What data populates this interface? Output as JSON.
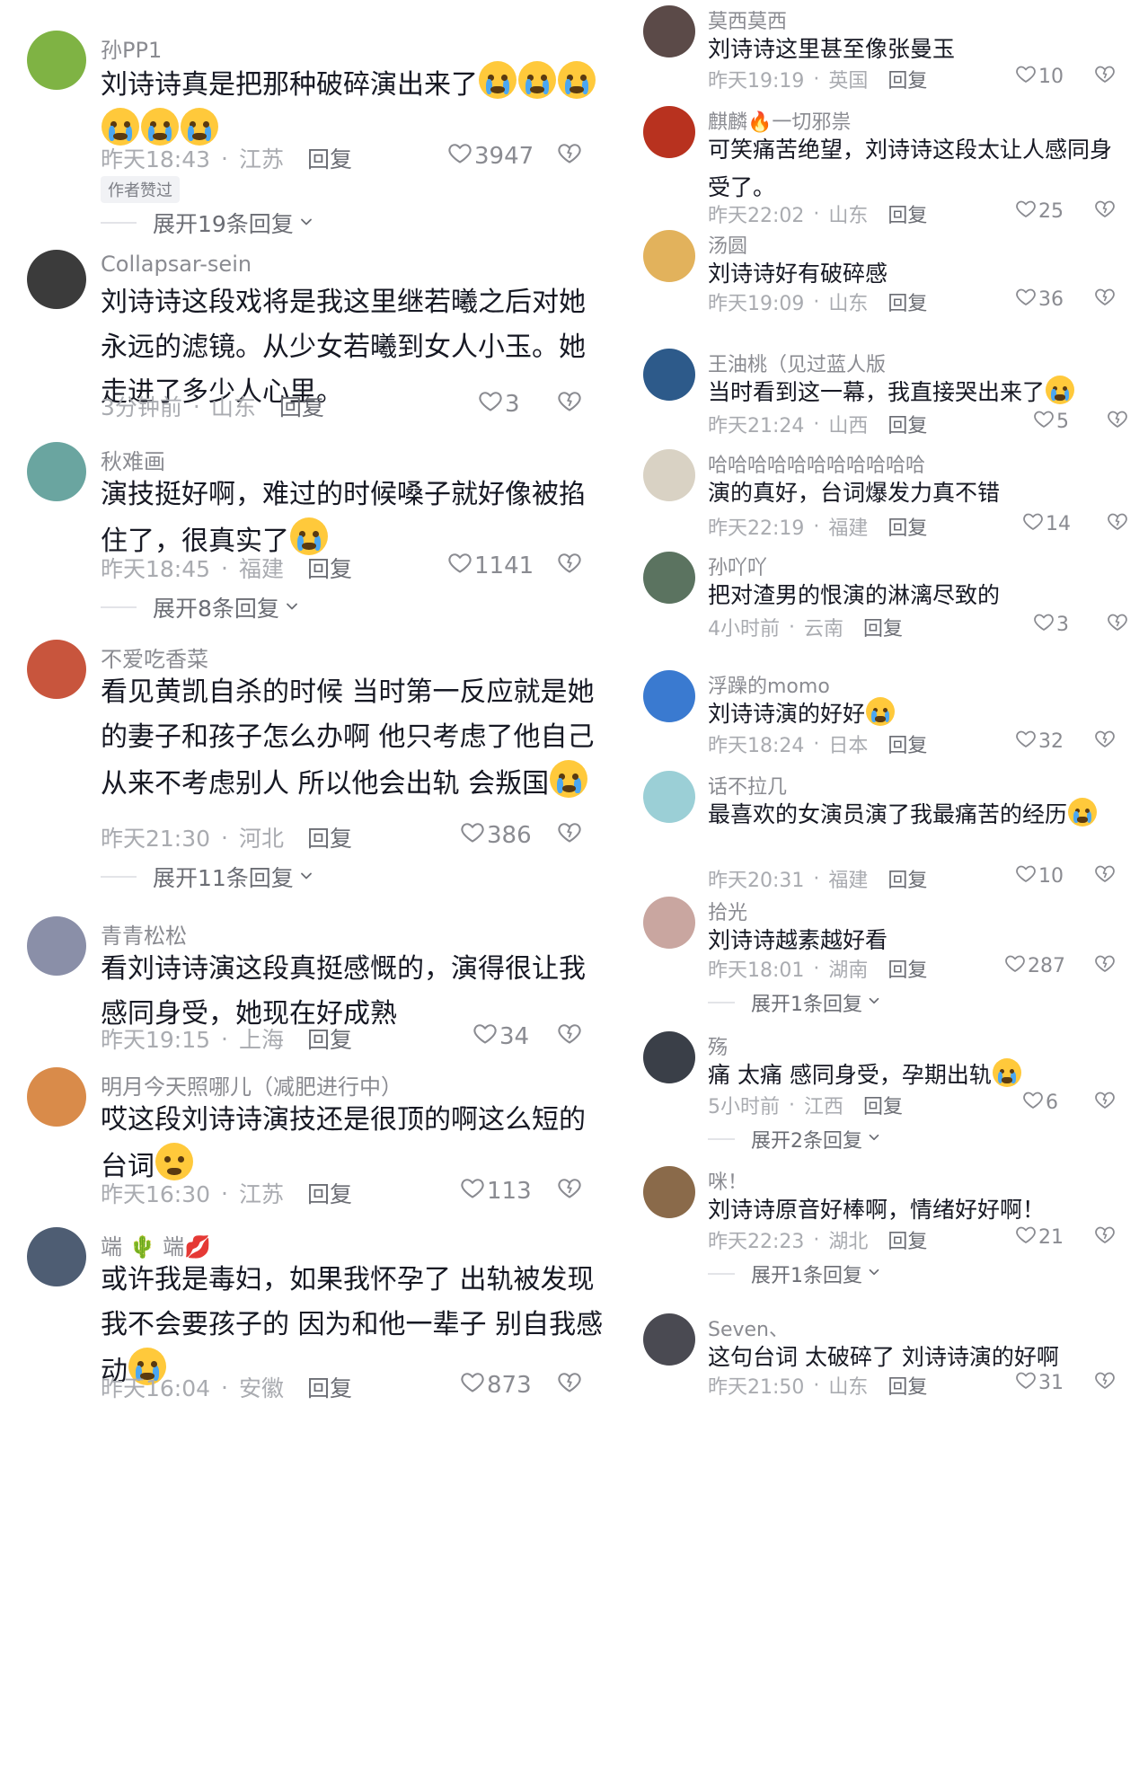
{
  "left": [
    {
      "name": "孙PP1",
      "text": "刘诗诗真是把那种破碎演出来了",
      "emojis": [
        "plead",
        "plead",
        "plead",
        "cry",
        "cry",
        "cry"
      ],
      "time": "昨天18:43",
      "location": "江苏",
      "reply": "回复",
      "likes": "3947",
      "author_tag": "作者赞过",
      "expand": "展开19条回复",
      "avatar_color": "#7fb344"
    },
    {
      "name": "Collapsar-sein",
      "text": "刘诗诗这段戏将是我这里继若曦之后对她永远的滤镜。从少女若曦到女人小玉。她走进了多少人心里。",
      "emojis": [],
      "time": "3分钟前",
      "location": "山东",
      "reply": "回复",
      "likes": "3",
      "avatar_color": "#3b3b3b"
    },
    {
      "name": "秋难画",
      "text": "演技挺好啊，难过的时候嗓子就好像被掐住了，很真实了",
      "emojis": [
        "cry"
      ],
      "time": "昨天18:45",
      "location": "福建",
      "reply": "回复",
      "likes": "1141",
      "expand": "展开8条回复",
      "avatar_color": "#6aa5a0"
    },
    {
      "name": "不爱吃香菜",
      "text": "看见黄凯自杀的时候 当时第一反应就是她的妻子和孩子怎么办啊 他只考虑了他自己 从来不考虑别人 所以他会出轨 会叛国",
      "emojis": [
        "cry"
      ],
      "time": "昨天21:30",
      "location": "河北",
      "reply": "回复",
      "likes": "386",
      "expand": "展开11条回复",
      "avatar_color": "#c8553d"
    },
    {
      "name": "青青松松",
      "text": "看刘诗诗演这段真挺感慨的，演得很让我感同身受，她现在好成熟",
      "emojis": [],
      "time": "昨天19:15",
      "location": "上海",
      "reply": "回复",
      "likes": "34",
      "avatar_color": "#8a8fa8"
    },
    {
      "name": "明月今天照哪儿（减肥进行中）",
      "text": "哎这段刘诗诗演技还是很顶的啊这么短的台词",
      "emojis": [
        "smile"
      ],
      "time": "昨天16:30",
      "location": "江苏",
      "reply": "回复",
      "likes": "113",
      "avatar_color": "#d98b4a"
    },
    {
      "name": "端 🌵 端💋",
      "text": "或许我是毒妇，如果我怀孕了 出轨被发现 我不会要孩子的 因为和他一辈子  别自我感动",
      "emojis": [
        "sweat"
      ],
      "time": "昨天16:04",
      "location": "安徽",
      "reply": "回复",
      "likes": "873",
      "avatar_color": "#4e5d73"
    }
  ],
  "right": [
    {
      "name": "莫西莫西",
      "text": "刘诗诗这里甚至像张曼玉",
      "emojis": [],
      "time": "昨天19:19",
      "location": "英国",
      "reply": "回复",
      "likes": "10",
      "avatar_color": "#5b4a48"
    },
    {
      "name": "麒麟🔥一切邪祟",
      "text": "可笑痛苦绝望，刘诗诗这段太让人感同身受了。",
      "emojis": [],
      "time": "昨天22:02",
      "location": "山东",
      "reply": "回复",
      "likes": "25",
      "avatar_color": "#b8321f"
    },
    {
      "name": "汤圆",
      "text": "刘诗诗好有破碎感",
      "emojis": [],
      "time": "昨天19:09",
      "location": "山东",
      "reply": "回复",
      "likes": "36",
      "avatar_color": "#e2b25c"
    },
    {
      "name": "王油桃（见过蓝人版",
      "text": "当时看到这一幕，我直接哭出来了",
      "emojis": [
        "cry"
      ],
      "time": "昨天21:24",
      "location": "山西",
      "reply": "回复",
      "likes": "5",
      "avatar_color": "#2d5a8a"
    },
    {
      "name": "哈哈哈哈哈哈哈哈哈哈哈",
      "text": "演的真好，台词爆发力真不错",
      "emojis": [],
      "time": "昨天22:19",
      "location": "福建",
      "reply": "回复",
      "likes": "14",
      "avatar_color": "#d9d2c4"
    },
    {
      "name": "孙吖吖",
      "text": "把对渣男的恨演的淋漓尽致的",
      "emojis": [],
      "time": "4小时前",
      "location": "云南",
      "reply": "回复",
      "likes": "3",
      "avatar_color": "#5b7360"
    },
    {
      "name": "浮躁的momo",
      "text": "刘诗诗演的好好",
      "emojis": [
        "cry"
      ],
      "time": "昨天18:24",
      "location": "日本",
      "reply": "回复",
      "likes": "32",
      "avatar_color": "#3a7ad0"
    },
    {
      "name": "话不拉几",
      "text": "最喜欢的女演员演了我最痛苦的经历",
      "emojis": [
        "sad"
      ],
      "time": "昨天20:31",
      "location": "福建",
      "reply": "回复",
      "likes": "10",
      "avatar_color": "#9bcfd6"
    },
    {
      "name": "拾光",
      "text": "刘诗诗越素越好看",
      "emojis": [],
      "time": "昨天18:01",
      "location": "湖南",
      "reply": "回复",
      "likes": "287",
      "expand": "展开1条回复",
      "avatar_color": "#c9a6a0"
    },
    {
      "name": "殇",
      "text": "痛 太痛 感同身受，孕期出轨",
      "emojis": [
        "cry"
      ],
      "time": "5小时前",
      "location": "江西",
      "reply": "回复",
      "likes": "6",
      "expand": "展开2条回复",
      "avatar_color": "#3a3f48"
    },
    {
      "name": "咪！",
      "text": "刘诗诗原音好棒啊，情绪好好啊！",
      "emojis": [],
      "time": "昨天22:23",
      "location": "湖北",
      "reply": "回复",
      "likes": "21",
      "expand": "展开1条回复",
      "avatar_color": "#8a6a4a"
    },
    {
      "name": "Seven、",
      "text": "这句台词 太破碎了 刘诗诗演的好啊",
      "emojis": [],
      "time": "昨天21:50",
      "location": "山东",
      "reply": "回复",
      "likes": "31",
      "avatar_color": "#4a4a52"
    }
  ]
}
